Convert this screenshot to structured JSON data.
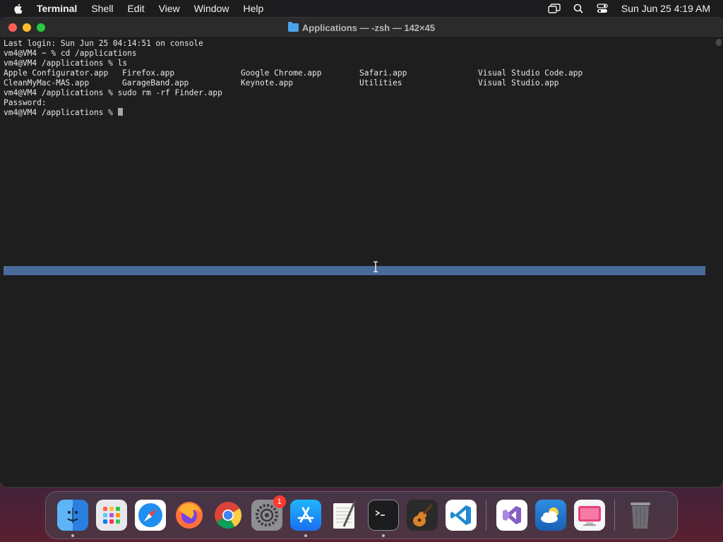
{
  "menubar": {
    "app_name": "Terminal",
    "menus": [
      "Shell",
      "Edit",
      "View",
      "Window",
      "Help"
    ],
    "clock": "Sun Jun 25  4:19 AM"
  },
  "window": {
    "title": "Applications — -zsh — 142×45"
  },
  "terminal": {
    "lines": [
      "Last login: Sun Jun 25 04:14:51 on console",
      "vm4@VM4 ~ % cd /applications",
      "vm4@VM4 /applications % ls"
    ],
    "ls_rows": [
      [
        "Apple Configurator.app",
        "Firefox.app",
        "Google Chrome.app",
        "Safari.app",
        "Visual Studio Code.app"
      ],
      [
        "CleanMyMac-MAS.app",
        "GarageBand.app",
        "Keynote.app",
        "Utilities",
        "Visual Studio.app"
      ]
    ],
    "after_lines": [
      "vm4@VM4 /applications % sudo rm -rf Finder.app",
      "Password:"
    ],
    "prompt": "vm4@VM4 /applications % "
  },
  "dock": {
    "items": [
      {
        "name": "finder",
        "running": true
      },
      {
        "name": "launchpad",
        "running": false
      },
      {
        "name": "safari",
        "running": false
      },
      {
        "name": "firefox",
        "running": false
      },
      {
        "name": "chrome",
        "running": false
      },
      {
        "name": "system-settings",
        "running": false,
        "badge": "1"
      },
      {
        "name": "app-store",
        "running": true
      },
      {
        "name": "textedit",
        "running": false
      },
      {
        "name": "terminal",
        "running": true
      },
      {
        "name": "garageband",
        "running": false
      },
      {
        "name": "vscode",
        "running": false
      },
      {
        "name": "visual-studio",
        "running": false
      },
      {
        "name": "weather",
        "running": false
      },
      {
        "name": "cleanmymac",
        "running": false
      },
      {
        "name": "trash",
        "running": false
      }
    ]
  }
}
